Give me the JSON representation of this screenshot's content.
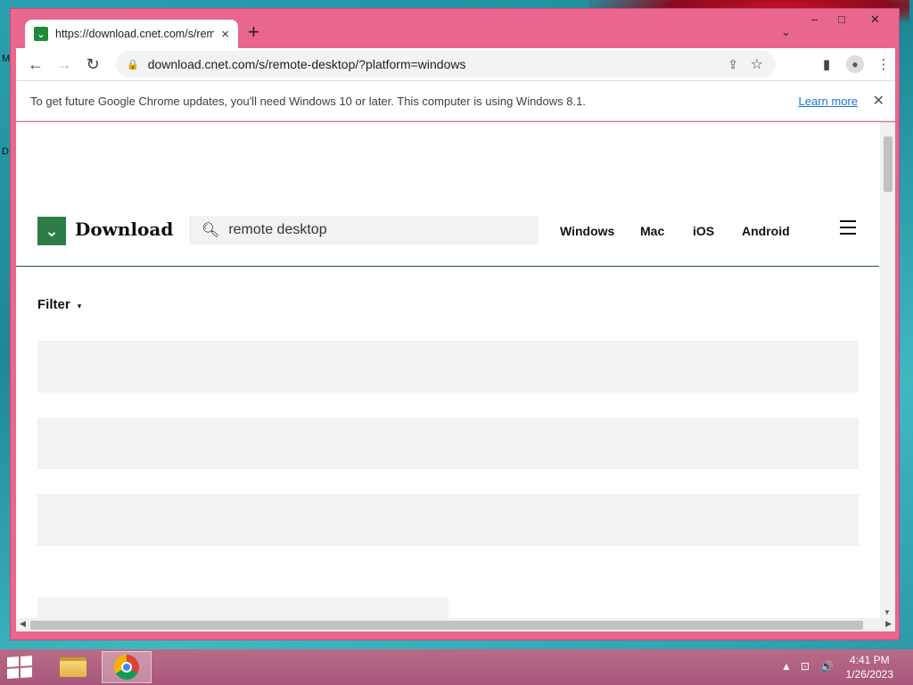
{
  "desktop": {
    "edge_labels": [
      "M",
      "D"
    ]
  },
  "browser": {
    "tab": {
      "favicon": "download-favicon",
      "title": "https://download.cnet.com/s/rem",
      "close": "×"
    },
    "new_tab": "+",
    "tab_search": "⌄",
    "window_controls": {
      "minimize": "–",
      "maximize": "□",
      "close": "✕"
    },
    "toolbar": {
      "back": "←",
      "forward": "→",
      "reload": "↻",
      "url": "download.cnet.com/s/remote-desktop/?platform=windows",
      "share": "⇪",
      "bookmark": "☆",
      "side_panel": "▮",
      "menu": "⋮"
    },
    "infobar": {
      "message": "To get future Google Chrome updates, you'll need Windows 10 or later. This computer is using Windows 8.1.",
      "link": "Learn more",
      "close": "✕"
    }
  },
  "site": {
    "logo_mark": "⌄",
    "logo_text": "Download",
    "search": {
      "value": "remote desktop",
      "placeholder": "Search"
    },
    "nav": [
      "Windows",
      "Mac",
      "iOS",
      "Android"
    ],
    "filter_label": "Filter",
    "filter_caret": "▾"
  },
  "taskbar": {
    "clock_time": "4:41 PM",
    "clock_date": "1/26/2023",
    "tray_arrow": "▲",
    "tray_network": "⊡",
    "tray_volume": "🔊"
  }
}
